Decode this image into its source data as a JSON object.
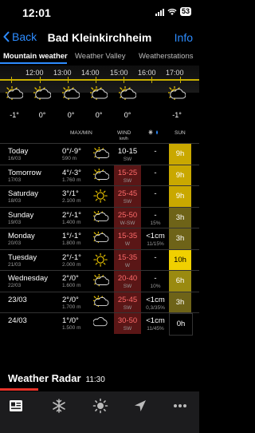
{
  "status": {
    "time": "12:01",
    "battery": "53"
  },
  "nav": {
    "back": "Back",
    "title": "Bad Kleinkirchheim",
    "info": "Info"
  },
  "tabs": [
    "Mountain weather",
    "Weather Valley",
    "Weatherstations"
  ],
  "hourly": {
    "hours": [
      "12:00",
      "13:00",
      "14:00",
      "15:00",
      "16:00",
      "17:00"
    ],
    "temps": [
      "-1°",
      "0°",
      "0°",
      "0°",
      "0°",
      "-1°"
    ]
  },
  "table_headers": {
    "maxmin": "MAX/MIN",
    "wind": "WIND",
    "wind_unit": "km/h",
    "sun": "SUN"
  },
  "days": [
    {
      "day": "Today",
      "date": "16/03",
      "temp": "0°/-9°",
      "alt": "590 m",
      "wind": "10-15",
      "dir": "SW",
      "red": false,
      "precip": "-",
      "precip2": "",
      "sun": "9h",
      "sunColor": "#c9a800",
      "sunText": "#fff",
      "icon": "sun-cloud-icon"
    },
    {
      "day": "Tomorrow",
      "date": "17/03",
      "temp": "4°/-3°",
      "alt": "1.760 m",
      "wind": "15-25",
      "dir": "SW",
      "red": true,
      "precip": "-",
      "precip2": "",
      "sun": "9h",
      "sunColor": "#c9a800",
      "sunText": "#fff",
      "icon": "sun-cloud-icon"
    },
    {
      "day": "Saturday",
      "date": "18/03",
      "temp": "3°/1°",
      "alt": "2.100 m",
      "wind": "25-45",
      "dir": "SW",
      "red": true,
      "precip": "-",
      "precip2": "",
      "sun": "9h",
      "sunColor": "#c9a800",
      "sunText": "#fff",
      "icon": "sun-icon"
    },
    {
      "day": "Sunday",
      "date": "19/03",
      "temp": "2°/-1°",
      "alt": "1.400 m",
      "wind": "25-50",
      "dir": "W-SW",
      "red": true,
      "precip": "-",
      "precip2": "15%",
      "sun": "3h",
      "sunColor": "#6e6318",
      "sunText": "#fff",
      "icon": "partly-cloudy-icon"
    },
    {
      "day": "Monday",
      "date": "20/03",
      "temp": "1°/-1°",
      "alt": "1.800 m",
      "wind": "15-35",
      "dir": "W",
      "red": true,
      "precip": "<1cm",
      "precip2": "11/15%",
      "sun": "3h",
      "sunColor": "#6e6318",
      "sunText": "#fff",
      "icon": "partly-cloudy-icon"
    },
    {
      "day": "Tuesday",
      "date": "21/03",
      "temp": "2°/-1°",
      "alt": "2.000 m",
      "wind": "15-35",
      "dir": "W",
      "red": true,
      "precip": "-",
      "precip2": "",
      "sun": "10h",
      "sunColor": "#f0d000",
      "sunText": "#000",
      "icon": "sun-icon"
    },
    {
      "day": "Wednesday",
      "date": "22/03",
      "temp": "2°/0°",
      "alt": "1.600 m",
      "wind": "20-40",
      "dir": "SW",
      "red": true,
      "precip": "-",
      "precip2": "10%",
      "sun": "6h",
      "sunColor": "#9a8a10",
      "sunText": "#fff",
      "icon": "sun-cloud-icon"
    },
    {
      "day": "23/03",
      "date": "",
      "temp": "2°/0°",
      "alt": "1.700 m",
      "wind": "25-45",
      "dir": "SW",
      "red": true,
      "precip": "<1cm",
      "precip2": "0,3/35%",
      "sun": "3h",
      "sunColor": "#6e6318",
      "sunText": "#fff",
      "icon": "partly-cloudy-icon"
    },
    {
      "day": "24/03",
      "date": "",
      "temp": "1°/0°",
      "alt": "1.500 m",
      "wind": "30-50",
      "dir": "SW",
      "red": true,
      "precip": "<1cm",
      "precip2": "11/45%",
      "sun": "0h",
      "sunColor": "#000",
      "sunText": "#fff",
      "icon": "cloud-icon"
    }
  ],
  "radar": {
    "title": "Weather Radar",
    "time": "11:30"
  },
  "tabbar": [
    "news-icon",
    "snowflake-icon",
    "sun-icon",
    "location-arrow-icon",
    "more-icon"
  ],
  "colors": {
    "accent": "#2d8cff",
    "wind_red": "#5a1616",
    "sun_yellow": "#f0d000",
    "radar_red": "#e8332a"
  }
}
